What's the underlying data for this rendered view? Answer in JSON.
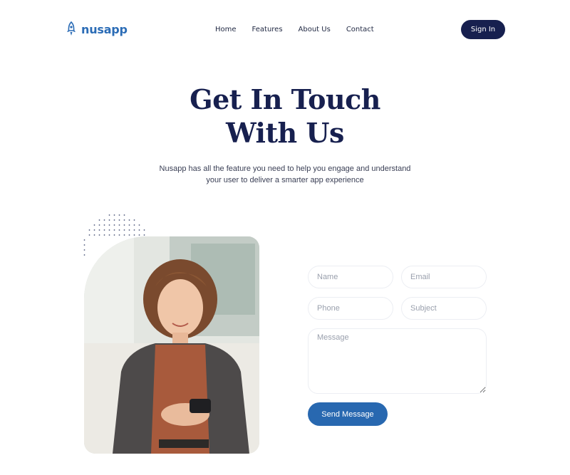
{
  "brand": {
    "name": "nusapp",
    "logo_icon": "rocket-icon",
    "color": "#2b6cb6"
  },
  "nav": {
    "items": [
      "Home",
      "Features",
      "About Us",
      "Contact"
    ]
  },
  "header": {
    "signin_label": "Sign In",
    "signin_color": "#17204f"
  },
  "hero": {
    "title_line1": "Get In Touch",
    "title_line2": "With Us",
    "subtitle_line1": "Nusapp has all the feature you need to help you engage and understand",
    "subtitle_line2": "your user to deliver a smarter app experience"
  },
  "form": {
    "name_placeholder": "Name",
    "email_placeholder": "Email",
    "phone_placeholder": "Phone",
    "subject_placeholder": "Subject",
    "message_placeholder": "Message",
    "send_label": "Send Message",
    "send_color": "#2868b0"
  }
}
